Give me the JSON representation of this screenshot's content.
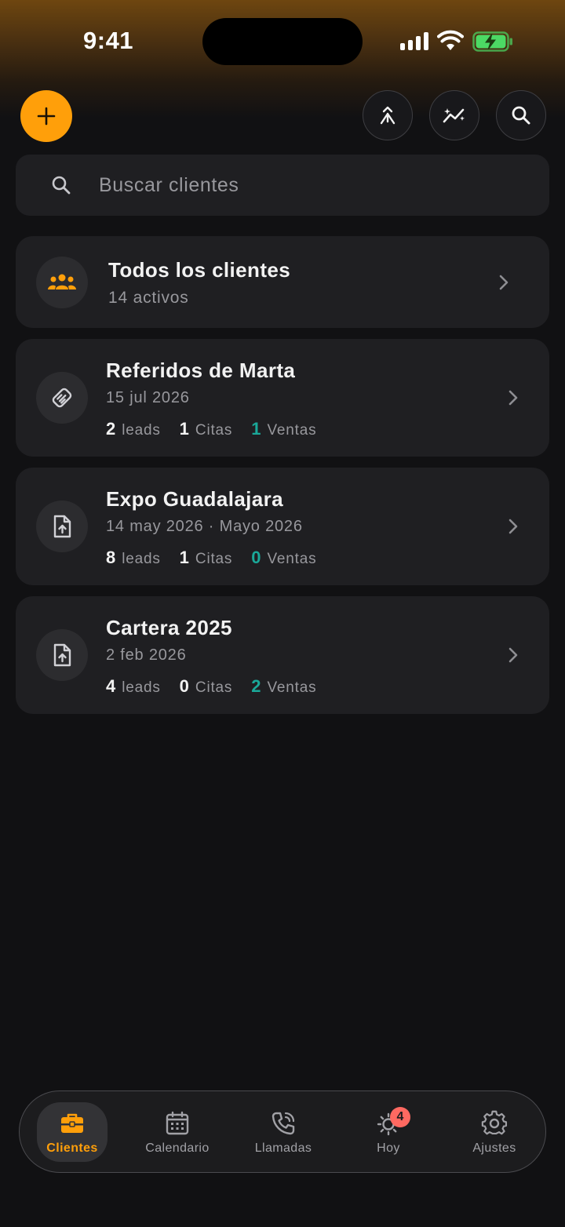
{
  "status_bar": {
    "time": "9:41"
  },
  "header": {
    "add_button": "add-icon",
    "actions": [
      "merge-icon",
      "sparkle-chart-icon",
      "search-icon"
    ]
  },
  "search": {
    "placeholder": "Buscar clientes",
    "value": ""
  },
  "all_clients": {
    "title": "Todos los clientes",
    "subtitle": "14 activos"
  },
  "groups": [
    {
      "title": "Referidos de Marta",
      "subtitle": "15 jul 2026",
      "icon": "handshake-icon",
      "leads": "2",
      "leads_label": "leads",
      "citas": "1",
      "citas_label": "Citas",
      "ventas": "1",
      "ventas_label": "Ventas"
    },
    {
      "title": "Expo Guadalajara",
      "subtitle": "14 may 2026 · Mayo 2026",
      "icon": "file-upload-icon",
      "leads": "8",
      "leads_label": "leads",
      "citas": "1",
      "citas_label": "Citas",
      "ventas": "0",
      "ventas_label": "Ventas"
    },
    {
      "title": "Cartera 2025",
      "subtitle": "2 feb 2026",
      "icon": "file-upload-icon",
      "leads": "4",
      "leads_label": "leads",
      "citas": "0",
      "citas_label": "Citas",
      "ventas": "2",
      "ventas_label": "Ventas"
    }
  ],
  "tabs": [
    {
      "label": "Clientes",
      "icon": "briefcase-icon",
      "active": true
    },
    {
      "label": "Calendario",
      "icon": "calendar-icon",
      "active": false
    },
    {
      "label": "Llamadas",
      "icon": "phone-icon",
      "active": false
    },
    {
      "label": "Hoy",
      "icon": "sun-icon",
      "active": false,
      "badge": "4"
    },
    {
      "label": "Ajustes",
      "icon": "gear-icon",
      "active": false
    }
  ],
  "colors": {
    "accent": "#ff9f0a",
    "positive": "#1aa899",
    "badge": "#ff6961",
    "background": "#111113",
    "card": "#1f1f22"
  }
}
